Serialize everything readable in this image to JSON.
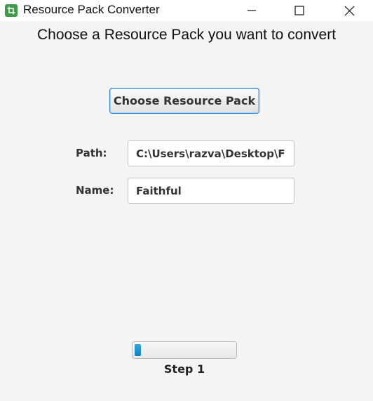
{
  "window": {
    "title": "Resource Pack Converter",
    "icon": "crop-icon",
    "controls": [
      "minimize-icon",
      "maximize-icon",
      "close-icon"
    ]
  },
  "main": {
    "heading": "Choose a Resource Pack you want to convert",
    "choose_button_label": "Choose Resource Pack",
    "path_label": "Path:",
    "path_value": "C:\\Users\\razva\\Desktop\\F",
    "name_label": "Name:",
    "name_value": "Faithful"
  },
  "progress": {
    "value_fraction": 0.06,
    "step_label": "Step 1"
  },
  "colors": {
    "app_icon": "#3e9b47",
    "button_focus_border": "#2b86d6",
    "progress_fill": "#0a82c8",
    "background": "#f4f4f4"
  }
}
